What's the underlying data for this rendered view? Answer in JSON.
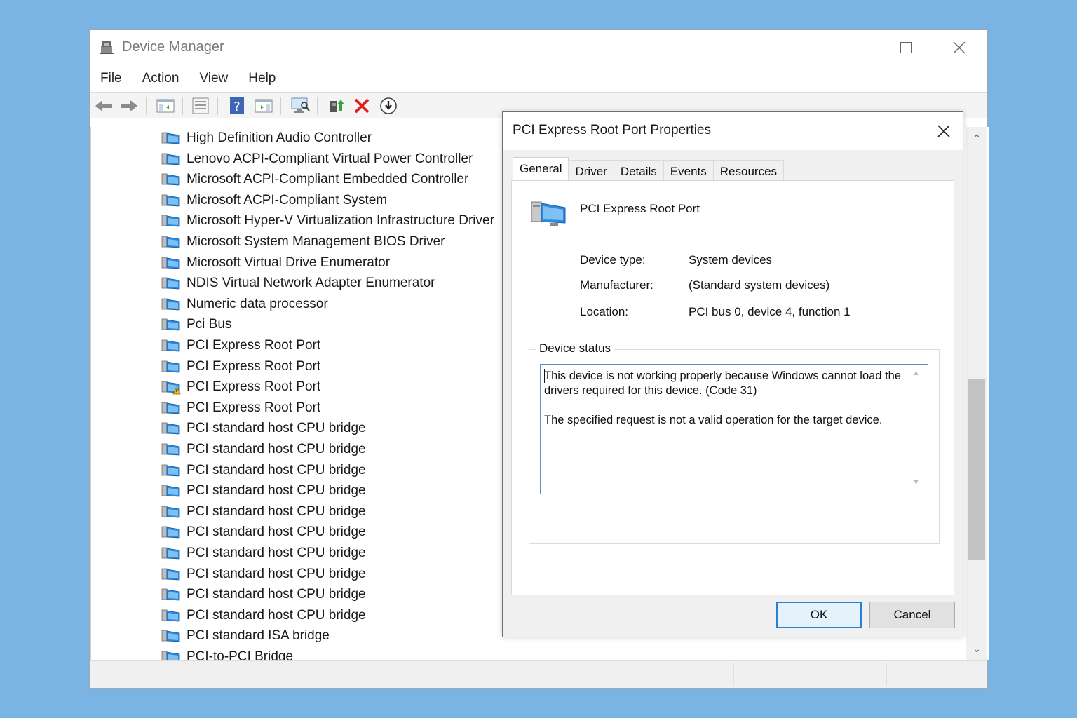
{
  "window": {
    "title": "Device Manager",
    "menu": [
      "File",
      "Action",
      "View",
      "Help"
    ]
  },
  "toolbar": {
    "buttons": [
      "back-icon",
      "forward-icon",
      "show-hide-console-tree-icon",
      "properties-icon",
      "help-icon",
      "action-pane-icon",
      "scan-hardware-icon",
      "update-driver-icon",
      "uninstall-icon",
      "disable-device-icon"
    ]
  },
  "tree": {
    "items": [
      {
        "label": "High Definition Audio Controller",
        "warning": false
      },
      {
        "label": "Lenovo ACPI-Compliant Virtual Power Controller",
        "warning": false
      },
      {
        "label": "Microsoft ACPI-Compliant Embedded Controller",
        "warning": false
      },
      {
        "label": "Microsoft ACPI-Compliant System",
        "warning": false
      },
      {
        "label": "Microsoft Hyper-V Virtualization Infrastructure Driver",
        "warning": false
      },
      {
        "label": "Microsoft System Management BIOS Driver",
        "warning": false
      },
      {
        "label": "Microsoft Virtual Drive Enumerator",
        "warning": false
      },
      {
        "label": "NDIS Virtual Network Adapter Enumerator",
        "warning": false
      },
      {
        "label": "Numeric data processor",
        "warning": false
      },
      {
        "label": "Pci Bus",
        "warning": false
      },
      {
        "label": "PCI Express Root Port",
        "warning": false
      },
      {
        "label": "PCI Express Root Port",
        "warning": false
      },
      {
        "label": "PCI Express Root Port",
        "warning": true
      },
      {
        "label": "PCI Express Root Port",
        "warning": false
      },
      {
        "label": "PCI standard host CPU bridge",
        "warning": false
      },
      {
        "label": "PCI standard host CPU bridge",
        "warning": false
      },
      {
        "label": "PCI standard host CPU bridge",
        "warning": false
      },
      {
        "label": "PCI standard host CPU bridge",
        "warning": false
      },
      {
        "label": "PCI standard host CPU bridge",
        "warning": false
      },
      {
        "label": "PCI standard host CPU bridge",
        "warning": false
      },
      {
        "label": "PCI standard host CPU bridge",
        "warning": false
      },
      {
        "label": "PCI standard host CPU bridge",
        "warning": false
      },
      {
        "label": "PCI standard host CPU bridge",
        "warning": false
      },
      {
        "label": "PCI standard host CPU bridge",
        "warning": false
      },
      {
        "label": "PCI standard ISA bridge",
        "warning": false
      },
      {
        "label": "PCI-to-PCI Bridge",
        "warning": false
      }
    ]
  },
  "dialog": {
    "title": "PCI Express Root Port Properties",
    "tabs": [
      "General",
      "Driver",
      "Details",
      "Events",
      "Resources"
    ],
    "active_tab": "General",
    "device_name": "PCI Express Root Port",
    "device_type_label": "Device type:",
    "device_type_value": "System devices",
    "manufacturer_label": "Manufacturer:",
    "manufacturer_value": "(Standard system devices)",
    "location_label": "Location:",
    "location_value": "PCI bus 0, device 4, function 1",
    "status_group_label": "Device status",
    "status_text": "This device is not working properly because Windows cannot load the drivers required for this device. (Code 31)\n\nThe specified request is not a valid operation for the target device.",
    "ok_label": "OK",
    "cancel_label": "Cancel"
  },
  "colors": {
    "desktop": "#79b4e3",
    "accent": "#2a7fd4",
    "delete_red": "#e0201f"
  }
}
